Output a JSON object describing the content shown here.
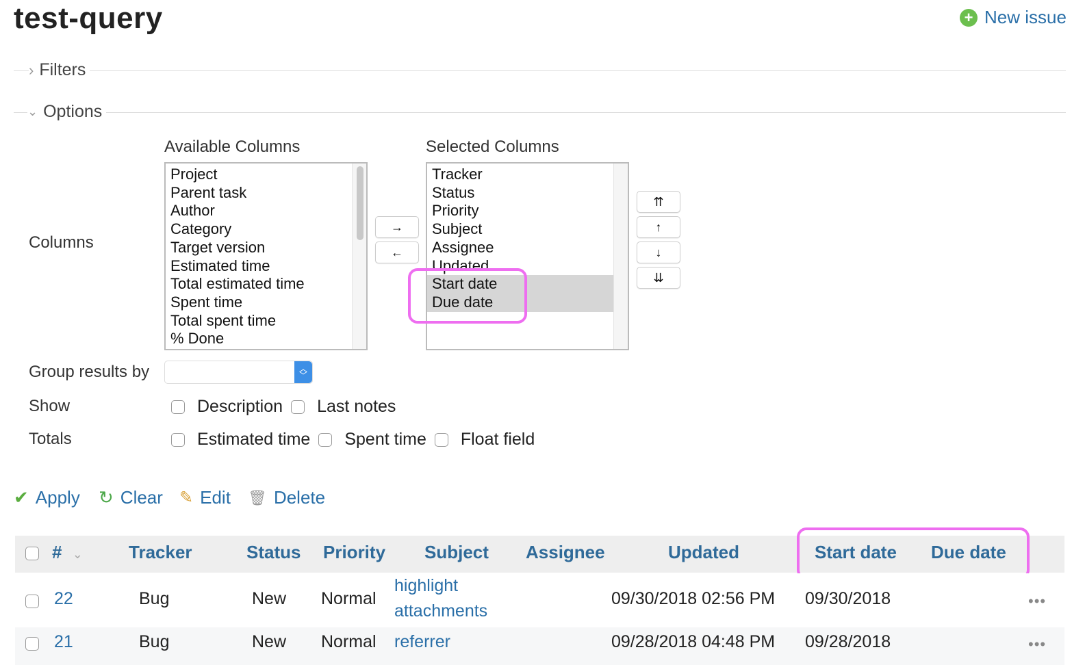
{
  "page": {
    "title": "test-query",
    "new_issue": "New issue"
  },
  "filters": {
    "label": "Filters"
  },
  "options": {
    "label": "Options",
    "columns_label": "Columns",
    "available_heading": "Available Columns",
    "selected_heading": "Selected Columns",
    "available": [
      "Project",
      "Parent task",
      "Author",
      "Category",
      "Target version",
      "Estimated time",
      "Total estimated time",
      "Spent time",
      "Total spent time",
      "% Done"
    ],
    "selected": [
      "Tracker",
      "Status",
      "Priority",
      "Subject",
      "Assignee",
      "Updated",
      "Start date",
      "Due date"
    ],
    "selected_highlighted": [
      "Start date",
      "Due date"
    ],
    "move_right": "→",
    "move_left": "←",
    "move_top": "⇈",
    "move_up": "↑",
    "move_down": "↓",
    "move_bottom": "⇊",
    "group_label": "Group results by",
    "group_value": "",
    "show_label": "Show",
    "show_items": [
      "Description",
      "Last notes"
    ],
    "totals_label": "Totals",
    "totals_items": [
      "Estimated time",
      "Spent time",
      "Float field"
    ]
  },
  "actions": {
    "apply": "Apply",
    "clear": "Clear",
    "edit": "Edit",
    "delete": "Delete"
  },
  "table": {
    "headers": {
      "id": "#",
      "tracker": "Tracker",
      "status": "Status",
      "priority": "Priority",
      "subject": "Subject",
      "assignee": "Assignee",
      "updated": "Updated",
      "start_date": "Start date",
      "due_date": "Due date"
    },
    "rows": [
      {
        "id": "22",
        "tracker": "Bug",
        "status": "New",
        "priority": "Normal",
        "subject_line1": "highlight",
        "subject_line2": "attachments",
        "updated": "09/30/2018 02:56 PM",
        "start_date": "09/30/2018",
        "due_date": ""
      },
      {
        "id": "21",
        "tracker": "Bug",
        "status": "New",
        "priority": "Normal",
        "subject_line1": "referrer",
        "subject_line2": "",
        "updated": "09/28/2018 04:48 PM",
        "start_date": "09/28/2018",
        "due_date": ""
      }
    ],
    "row_menu": "•••"
  },
  "colors": {
    "link": "#2a6fa8",
    "header_text": "#2f6a99",
    "highlight_ring": "#ee6ef0",
    "header_bg": "#eeeeee"
  }
}
